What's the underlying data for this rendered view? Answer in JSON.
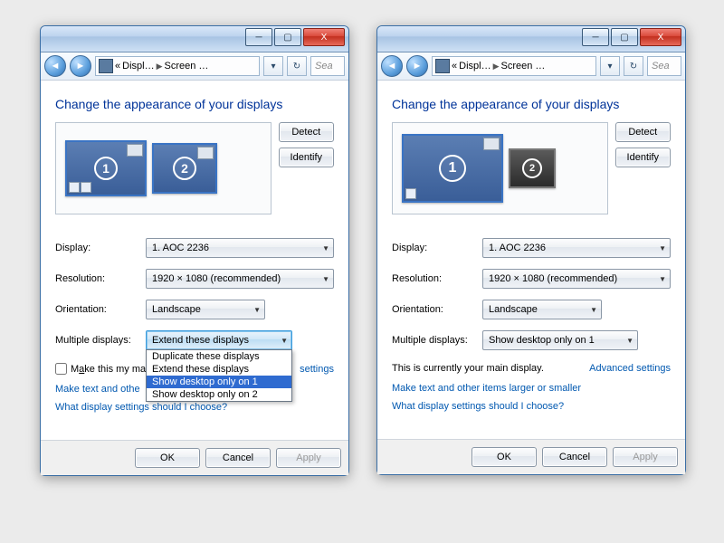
{
  "win_buttons": {
    "min": "─",
    "max": "▢",
    "close": "X"
  },
  "toolbar": {
    "crumb_prefix": "«",
    "crumb1": "Displ…",
    "crumb2": "Screen …",
    "refresh": "↻",
    "search_placeholder": "Sea"
  },
  "heading": "Change the appearance of your displays",
  "monitors": {
    "one": "1",
    "two": "2"
  },
  "buttons": {
    "detect": "Detect",
    "identify": "Identify",
    "ok": "OK",
    "cancel": "Cancel",
    "apply": "Apply"
  },
  "fields": {
    "display_label": "Display:",
    "display_value": "1. AOC 2236",
    "resolution_label": "Resolution:",
    "resolution_value": "1920 × 1080 (recommended)",
    "orientation_label": "Orientation:",
    "orientation_value": "Landscape",
    "multi_label": "Multiple displays:"
  },
  "left": {
    "multi_value": "Extend these displays",
    "dd_options": [
      "Duplicate these displays",
      "Extend these displays",
      "Show desktop only on 1",
      "Show desktop only on 2"
    ],
    "dd_selected_index": 2,
    "checkbox_partial": "Make this my ma",
    "adv_partial": "settings",
    "link1_partial": "Make text and othe",
    "link2": "What display settings should I choose?"
  },
  "right": {
    "multi_value": "Show desktop only on 1",
    "main_display_text": "This is currently your main display.",
    "adv": "Advanced settings",
    "link1": "Make text and other items larger or smaller",
    "link2": "What display settings should I choose?"
  }
}
